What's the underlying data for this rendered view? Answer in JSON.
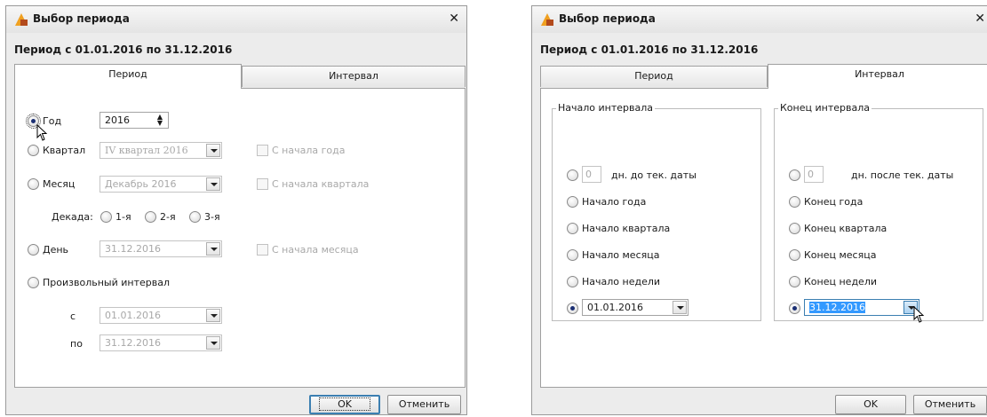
{
  "dialog1": {
    "title": "Выбор периода",
    "period_text": "Период с 01.01.2016 по 31.12.2016",
    "tabs": [
      "Период",
      "Интервал"
    ],
    "year": {
      "label": "Год",
      "value": "2016",
      "selected": true
    },
    "quarter": {
      "label": "Квартал",
      "value": "IV квартал 2016",
      "checkbox": "С начала года"
    },
    "month": {
      "label": "Месяц",
      "value": "Декабрь 2016",
      "checkbox": "С начала квартала"
    },
    "decade": {
      "label": "Декада:",
      "options": [
        "1-я",
        "2-я",
        "3-я"
      ]
    },
    "day": {
      "label": "День",
      "value": "31.12.2016",
      "checkbox": "С начала месяца"
    },
    "custom": {
      "label": "Произвольный интервал",
      "from_label": "с",
      "from_value": "01.01.2016",
      "to_label": "по",
      "to_value": "31.12.2016"
    },
    "buttons": {
      "ok": "OK",
      "cancel": "Отменить"
    }
  },
  "dialog2": {
    "title": "Выбор периода",
    "period_text": "Период с 01.01.2016 по 31.12.2016",
    "tabs": [
      "Период",
      "Интервал"
    ],
    "start": {
      "legend": "Начало интервала",
      "days_value": "0",
      "days_label": "дн. до тек. даты",
      "options": [
        "Начало года",
        "Начало квартала",
        "Начало месяца",
        "Начало недели"
      ],
      "date_value": "01.01.2016"
    },
    "end": {
      "legend": "Конец интервала",
      "days_value": "0",
      "days_label": "дн. после тек. даты",
      "options": [
        "Конец года",
        "Конец квартала",
        "Конец месяца",
        "Конец недели"
      ],
      "date_value": "31.12.2016"
    },
    "buttons": {
      "ok": "OK",
      "cancel": "Отменить"
    }
  },
  "colors": {
    "dialog_bg": "#ececec",
    "focus_blue": "#3c7fb1",
    "app_icon": "#f0a020"
  },
  "icons": [
    "app-icon",
    "close-icon",
    "chevron-down-icon",
    "spinner-icon",
    "mouse-cursor-icon"
  ]
}
